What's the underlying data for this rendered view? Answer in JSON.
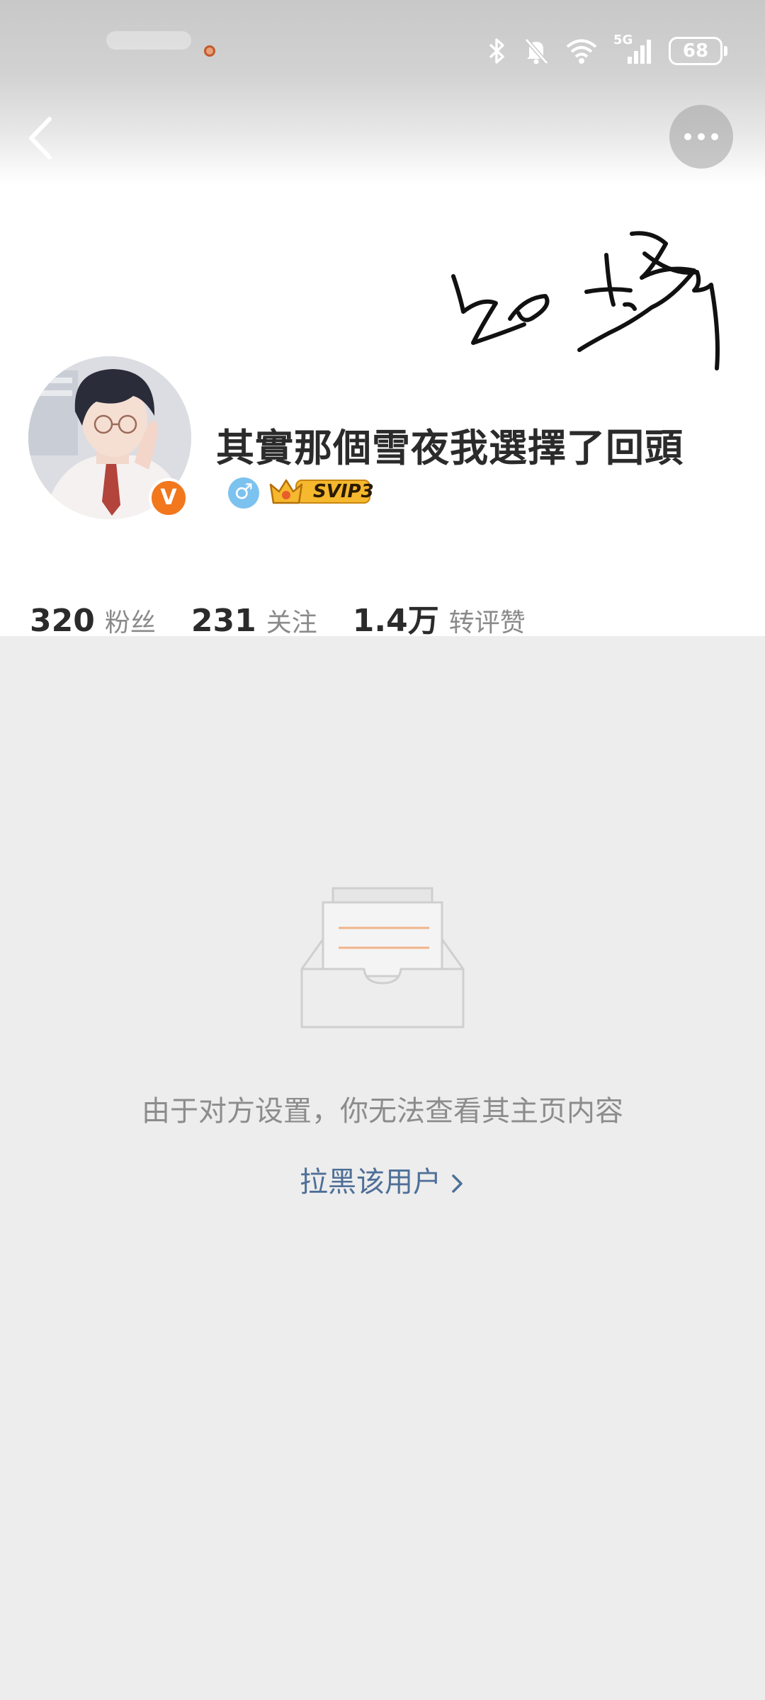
{
  "status_bar": {
    "network": "5G",
    "battery": "68",
    "icons": [
      "bluetooth-icon",
      "mute-bell-icon",
      "wifi-icon",
      "signal-icon",
      "battery-icon"
    ]
  },
  "nav": {
    "back_icon": "chevron-left-icon",
    "more_icon": "more-dots-icon"
  },
  "profile": {
    "nickname": "其實那個雪夜我選擇了回頭",
    "gender_symbol": "♂",
    "verified_symbol": "V",
    "vip_label": "SVIP3"
  },
  "stats": {
    "followers_count": "320",
    "followers_label": "粉丝",
    "following_count": "231",
    "following_label": "关注",
    "interactions_count": "1.4万",
    "interactions_label": "转评赞"
  },
  "empty_state": {
    "icon": "empty-inbox-icon",
    "message": "由于对方设置，你无法查看其主页内容",
    "block_link": "拉黑该用户"
  },
  "colors": {
    "accent_link": "#4e6f98",
    "verified_orange": "#f2771d",
    "background": "#ededed"
  }
}
